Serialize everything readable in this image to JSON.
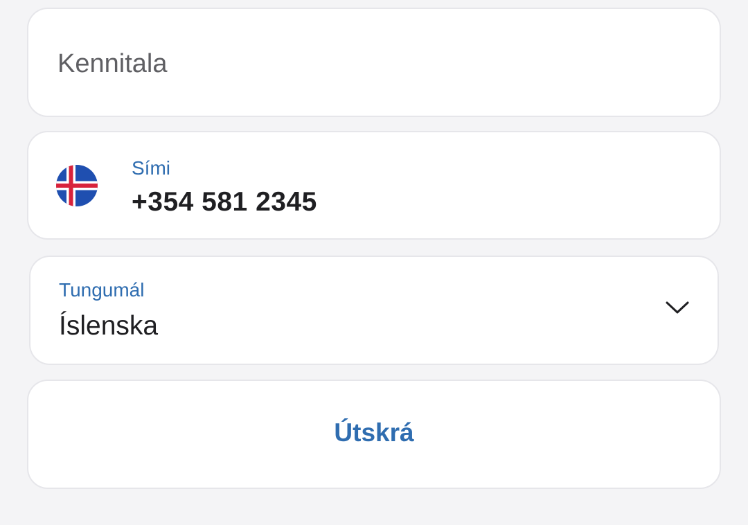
{
  "kennitala": {
    "placeholder": "Kennitala",
    "value": ""
  },
  "phone": {
    "label": "Sími",
    "value": "+354 581 2345",
    "country_flag_icon": "iceland-flag-icon"
  },
  "language": {
    "label": "Tungumál",
    "selected": "Íslenska",
    "icon": "chevron-down-icon"
  },
  "logout": {
    "label": "Útskrá"
  },
  "colors": {
    "accent": "#2f6db0",
    "text": "#1f1f22",
    "placeholder": "#5f5f63",
    "background": "#f4f4f6",
    "card": "#ffffff",
    "border": "#e6e6ea"
  }
}
